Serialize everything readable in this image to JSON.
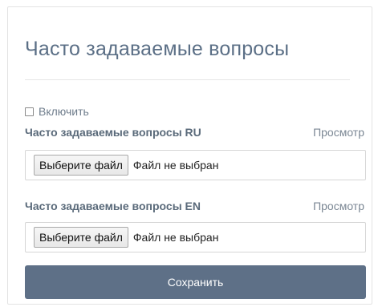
{
  "panel": {
    "title": "Часто задаваемые вопросы"
  },
  "enable": {
    "label": "Включить",
    "checked": false
  },
  "sections": [
    {
      "label": "Часто задаваемые вопросы RU",
      "preview_label": "Просмотр",
      "file_button_label": "Выберите файл",
      "file_status": "Файл не выбран"
    },
    {
      "label": "Часто задаваемые вопросы EN",
      "preview_label": "Просмотр",
      "file_button_label": "Выберите файл",
      "file_status": "Файл не выбран"
    }
  ],
  "save_button_label": "Сохранить",
  "colors": {
    "title": "#5b6f86",
    "save_button": "#5e7087",
    "label": "#5a6a7a"
  }
}
